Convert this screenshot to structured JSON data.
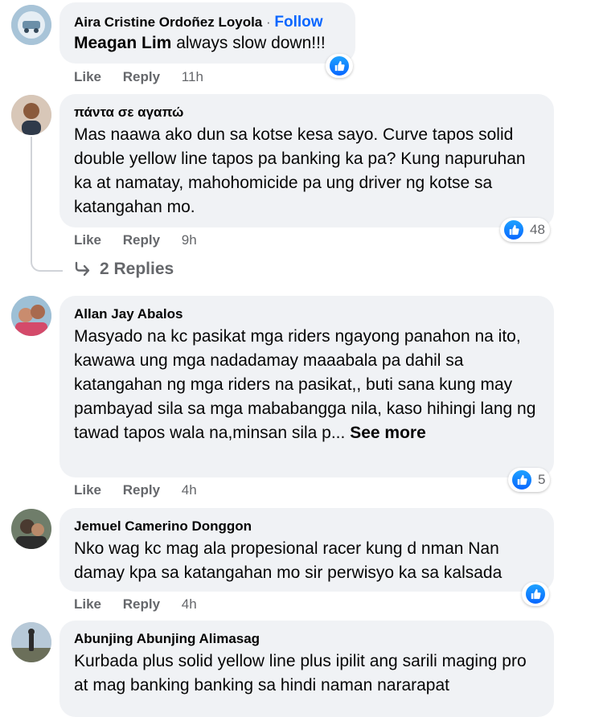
{
  "colors": {
    "accent": "#0866ff",
    "bubble": "#f0f2f5",
    "muted": "#65676b"
  },
  "comments": [
    {
      "author": "Aira Cristine Ordoñez Loyola",
      "separator": "·",
      "follow": "Follow",
      "mention": "Meagan Lim",
      "text": " always slow down!!!",
      "like": "Like",
      "reply": "Reply",
      "time": "11h"
    },
    {
      "author": "πάντα σε αγαπώ",
      "text": "Mas naawa ako dun sa kotse kesa sayo. Curve tapos solid double yellow line tapos pa banking ka pa? Kung napuruhan ka at namatay, mahohomicide pa ung driver ng kotse sa katangahan mo.",
      "like": "Like",
      "reply": "Reply",
      "time": "9h",
      "reactions": "48",
      "replies": "2 Replies"
    },
    {
      "author": "Allan Jay Abalos",
      "text": "Masyado na kc pasikat mga riders ngayong panahon na ito, kawawa ung mga nadadamay maaabala pa dahil sa katangahan ng mga riders na pasikat,, buti sana kung may pambayad sila sa mga mababangga nila, kaso hihingi lang ng tawad tapos wala na,minsan sila p...",
      "see_more": " See more",
      "like": "Like",
      "reply": "Reply",
      "time": "4h",
      "reactions": "5"
    },
    {
      "author": "Jemuel Camerino Donggon",
      "text": "Nko wag kc mag ala propesional racer kung d nman Nan damay kpa sa katangahan mo sir perwisyo ka sa kalsada",
      "like": "Like",
      "reply": "Reply",
      "time": "4h"
    },
    {
      "author": "Abunjing Abunjing Alimasag",
      "text": "Kurbada plus solid yellow line plus ipilit ang sarili maging pro at mag banking banking sa hindi naman nararapat"
    }
  ]
}
